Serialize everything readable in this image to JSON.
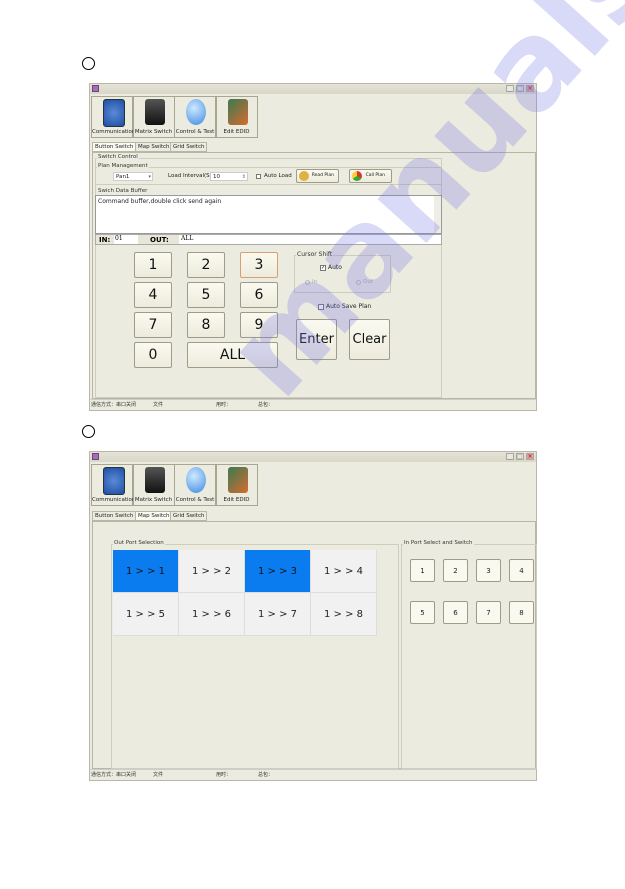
{
  "toolbar": {
    "items": [
      {
        "label": "Communication",
        "icon": "app-store-icon"
      },
      {
        "label": "Matrix Switch",
        "icon": "matrix-icon"
      },
      {
        "label": "Control & Test",
        "icon": "globe-icon"
      },
      {
        "label": "Edit EDID",
        "icon": "edid-edit-icon"
      }
    ]
  },
  "tabs": [
    "Button Switch",
    "Map Switch",
    "Grid Switch"
  ],
  "status": {
    "comm": "通信方式：串口关闭",
    "file": "文件",
    "time": "用时：",
    "total": "总包："
  },
  "screen1": {
    "active_tab": "Button Switch",
    "switch_control": "Switch Control",
    "plan_management": "Plan Management",
    "plan_select": "Pan1",
    "load_interval_label": "Load Interval(S)",
    "load_interval_value": "10",
    "auto_load": "Auto Load",
    "auto_load_checked": false,
    "read_plan": "Read Plan",
    "call_plan": "Call Plan",
    "buffer_label": "Swich Data Buffer",
    "buffer_text": "Command buffer,double click send again",
    "in_label": "IN:",
    "in_value": "01",
    "out_label": "OUT:",
    "out_value": "ALL",
    "keys": [
      "1",
      "2",
      "3",
      "4",
      "5",
      "6",
      "7",
      "8",
      "9",
      "0",
      "ALL"
    ],
    "cursor_shift": "Cursor Shift",
    "auto": "Auto",
    "auto_checked": true,
    "radio_in": "In",
    "radio_out": "Out",
    "auto_save_plan": "Auto Save Plan",
    "auto_save_checked": false,
    "enter": "Enter",
    "clear": "Clear"
  },
  "screen2": {
    "active_tab": "Map Switch",
    "out_port_label": "Out Port Selection",
    "out_cells": [
      {
        "label": "1 > > 1",
        "selected": true
      },
      {
        "label": "1 > > 2",
        "selected": false
      },
      {
        "label": "1 > > 3",
        "selected": true
      },
      {
        "label": "1 > > 4",
        "selected": false
      },
      {
        "label": "1 > > 5",
        "selected": false
      },
      {
        "label": "1 > > 6",
        "selected": false
      },
      {
        "label": "1 > > 7",
        "selected": false
      },
      {
        "label": "1 > > 8",
        "selected": false
      }
    ],
    "in_port_label": "In Port Select and Switch",
    "in_buttons": [
      "1",
      "2",
      "3",
      "4",
      "5",
      "6",
      "7",
      "8"
    ]
  },
  "colors": {
    "selected": "#0a7cf0",
    "window_bg": "#ecebdf"
  },
  "watermark": "manualshive.com"
}
